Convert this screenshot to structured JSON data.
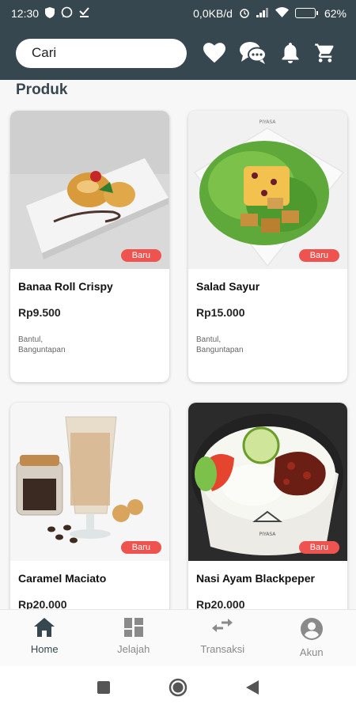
{
  "status_bar": {
    "time": "12:30",
    "network_speed": "0,0KB/d",
    "battery_level": "62%",
    "battery_fraction": 0.62,
    "icons": [
      "shield-icon",
      "whatsapp-icon",
      "download-done-icon",
      "alarm-icon",
      "signal-icon",
      "wifi-icon",
      "battery-icon"
    ]
  },
  "header": {
    "search_placeholder": "Cari",
    "icons": [
      "heart-icon",
      "chat-icon",
      "bell-icon",
      "cart-icon"
    ]
  },
  "section_title": "Produk",
  "products": [
    {
      "name": "Banaa Roll Crispy",
      "price": "Rp9.500",
      "location": "Bantul,\nBanguntapan",
      "badge": "Baru"
    },
    {
      "name": "Salad Sayur",
      "price": "Rp15.000",
      "location": "Bantul,\nBanguntapan",
      "badge": "Baru"
    },
    {
      "name": "Caramel Maciato",
      "price": "Rp20.000",
      "location": "",
      "badge": "Baru"
    },
    {
      "name": "Nasi Ayam Blackpeper",
      "price": "Rp20.000",
      "location": "",
      "badge": "Baru"
    }
  ],
  "bottom_nav": [
    {
      "label": "Home",
      "icon": "home-icon",
      "active": true
    },
    {
      "label": "Jelajah",
      "icon": "dashboard-icon",
      "active": false
    },
    {
      "label": "Transaksi",
      "icon": "swap-icon",
      "active": false
    },
    {
      "label": "Akun",
      "icon": "account-icon",
      "active": false
    }
  ],
  "colors": {
    "primary": "#37474f",
    "badge": "#ef5350",
    "inactive": "#8a8a8a"
  }
}
